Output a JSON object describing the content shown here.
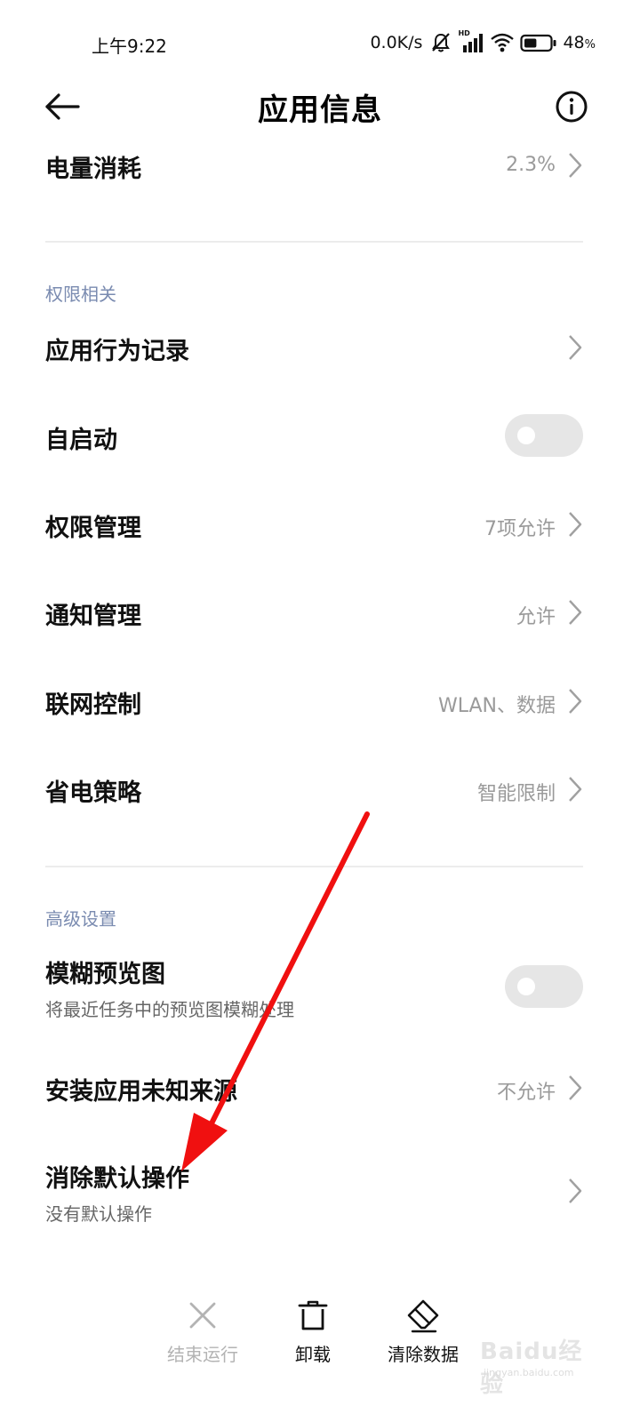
{
  "status_bar": {
    "time": "上午9:22",
    "net_speed": "0.0K/s",
    "hd": "HD",
    "battery_percent": "48",
    "battery_unit": "%",
    "battery_level": 0.48
  },
  "header": {
    "title": "应用信息"
  },
  "rows": {
    "battery_usage": {
      "title": "电量消耗",
      "value": "2.3%"
    },
    "behavior_log": {
      "title": "应用行为记录"
    },
    "autostart": {
      "title": "自启动",
      "enabled": false
    },
    "permissions": {
      "title": "权限管理",
      "value": "7项允许"
    },
    "notifications": {
      "title": "通知管理",
      "value": "允许"
    },
    "network": {
      "title": "联网控制",
      "value": "WLAN、数据"
    },
    "power_saving": {
      "title": "省电策略",
      "value": "智能限制"
    },
    "blur_preview": {
      "title": "模糊预览图",
      "subtitle": "将最近任务中的预览图模糊处理",
      "enabled": false
    },
    "unknown_sources": {
      "title": "安装应用未知来源",
      "value": "不允许"
    },
    "clear_defaults": {
      "title": "消除默认操作",
      "subtitle": "没有默认操作"
    }
  },
  "sections": {
    "permissions_label": "权限相关",
    "advanced_label": "高级设置"
  },
  "bottom_bar": {
    "force_stop": "结束运行",
    "uninstall": "卸载",
    "clear_data": "清除数据"
  },
  "watermark": {
    "text": "Baidu经验",
    "url": "jingyan.baidu.com"
  },
  "colors": {
    "section_label": "#7a8bb0",
    "annotation_arrow": "#f01010",
    "toggle_off": "#e6e6e6"
  }
}
